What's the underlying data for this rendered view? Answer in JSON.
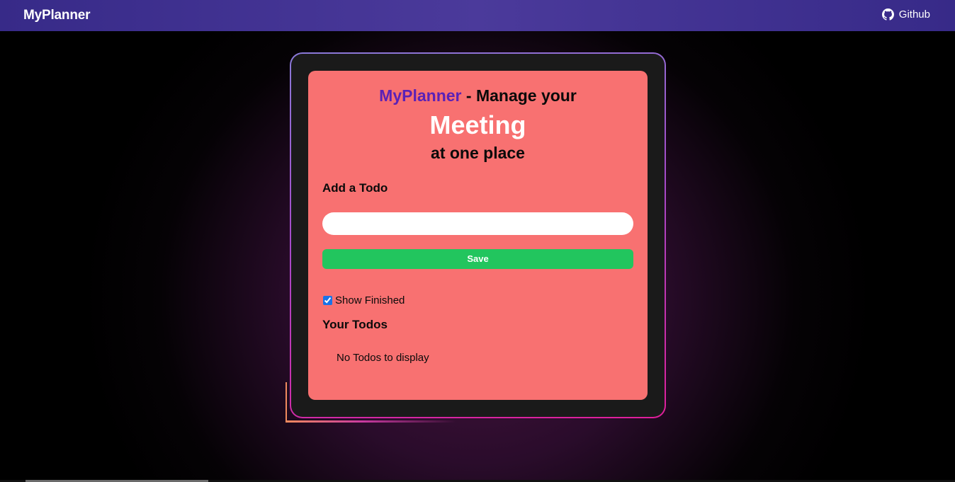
{
  "navbar": {
    "brand": "MyPlanner",
    "github_label": "Github",
    "github_icon": "github-icon"
  },
  "hero": {
    "app_name": "MyPlanner",
    "manage_text": " - Manage your",
    "highlight_word": "Meeting",
    "tagline": "at one place"
  },
  "add_todo": {
    "heading": "Add a Todo",
    "input_value": "",
    "input_placeholder": "",
    "save_label": "Save"
  },
  "filters": {
    "show_finished_label": "Show Finished",
    "show_finished_checked": true
  },
  "todos": {
    "heading": "Your Todos",
    "empty_message": "No Todos to display",
    "items": []
  },
  "colors": {
    "navbar": "#4b3a9b",
    "card": "#f87171",
    "app_name": "#5b21b6",
    "save_button": "#22c55e",
    "frame": "#1a1a1a"
  }
}
